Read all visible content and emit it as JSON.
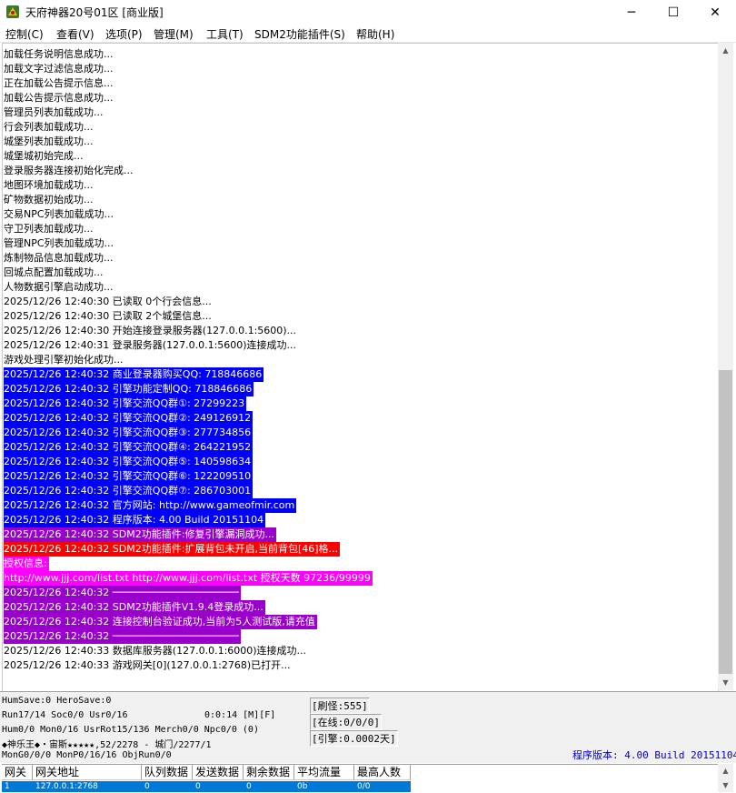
{
  "window": {
    "title": "天府神器20号01区 [商业版]",
    "minimize": "─",
    "maximize": "☐",
    "close": "✕"
  },
  "menu": [
    "控制(C)",
    "查看(V)",
    "选项(P)",
    "管理(M)",
    "工具(T)",
    "SDM2功能插件(S)",
    "帮助(H)"
  ],
  "colors": {
    "blue_highlight": "#0000ff",
    "purple_highlight": "#9900cc",
    "red_highlight": "#ff0000",
    "magenta_highlight": "#ff00ff",
    "selection": "#0078d7"
  },
  "log_lines": [
    {
      "text": "加载任务说明信息成功...",
      "bg": "",
      "fg": ""
    },
    {
      "text": "加载文字过滤信息成功...",
      "bg": "",
      "fg": ""
    },
    {
      "text": "正在加载公告提示信息...",
      "bg": "",
      "fg": ""
    },
    {
      "text": "加载公告提示信息成功...",
      "bg": "",
      "fg": ""
    },
    {
      "text": "管理员列表加载成功...",
      "bg": "",
      "fg": ""
    },
    {
      "text": "行会列表加载成功...",
      "bg": "",
      "fg": ""
    },
    {
      "text": "城堡列表加载成功...",
      "bg": "",
      "fg": ""
    },
    {
      "text": "城堡城初始完成...",
      "bg": "",
      "fg": ""
    },
    {
      "text": "登录服务器连接初始化完成...",
      "bg": "",
      "fg": ""
    },
    {
      "text": "地图环境加载成功...",
      "bg": "",
      "fg": ""
    },
    {
      "text": "矿物数据初始成功...",
      "bg": "",
      "fg": ""
    },
    {
      "text": "交易NPC列表加载成功...",
      "bg": "",
      "fg": ""
    },
    {
      "text": "守卫列表加载成功...",
      "bg": "",
      "fg": ""
    },
    {
      "text": "管理NPC列表加载成功...",
      "bg": "",
      "fg": ""
    },
    {
      "text": "炼制物品信息加载成功...",
      "bg": "",
      "fg": ""
    },
    {
      "text": "回城点配置加载成功...",
      "bg": "",
      "fg": ""
    },
    {
      "text": "人物数据引擎启动成功...",
      "bg": "",
      "fg": ""
    },
    {
      "text": "2025/12/26 12:40:30 已读取 0个行会信息...",
      "bg": "",
      "fg": ""
    },
    {
      "text": "2025/12/26 12:40:30 已读取 2个城堡信息...",
      "bg": "",
      "fg": ""
    },
    {
      "text": "2025/12/26 12:40:30 开始连接登录服务器(127.0.0.1:5600)...",
      "bg": "",
      "fg": ""
    },
    {
      "text": "2025/12/26 12:40:31 登录服务器(127.0.0.1:5600)连接成功...",
      "bg": "",
      "fg": ""
    },
    {
      "text": "游戏处理引擎初始化成功...",
      "bg": "",
      "fg": ""
    },
    {
      "text": "2025/12/26 12:40:32 商业登录器购买QQ: 718846686",
      "bg": "#0000ff",
      "fg": "#ffffff"
    },
    {
      "text": "2025/12/26 12:40:32 引擎功能定制QQ: 718846686",
      "bg": "#0000ff",
      "fg": "#ffffff"
    },
    {
      "text": "2025/12/26 12:40:32 引擎交流QQ群①: 27299223",
      "bg": "#0000ff",
      "fg": "#ffffff"
    },
    {
      "text": "2025/12/26 12:40:32 引擎交流QQ群②: 249126912",
      "bg": "#0000ff",
      "fg": "#ffffff"
    },
    {
      "text": "2025/12/26 12:40:32 引擎交流QQ群③: 277734856",
      "bg": "#0000ff",
      "fg": "#ffffff"
    },
    {
      "text": "2025/12/26 12:40:32 引擎交流QQ群④: 264221952",
      "bg": "#0000ff",
      "fg": "#ffffff"
    },
    {
      "text": "2025/12/26 12:40:32 引擎交流QQ群⑤: 140598634",
      "bg": "#0000ff",
      "fg": "#ffffff"
    },
    {
      "text": "2025/12/26 12:40:32 引擎交流QQ群⑥: 122209510",
      "bg": "#0000ff",
      "fg": "#ffffff"
    },
    {
      "text": "2025/12/26 12:40:32 引擎交流QQ群⑦: 286703001",
      "bg": "#0000ff",
      "fg": "#ffffff"
    },
    {
      "text": "2025/12/26 12:40:32 官方网站: http://www.gameofmir.com",
      "bg": "#0000ff",
      "fg": "#ffffff"
    },
    {
      "text": "2025/12/26 12:40:32 程序版本: 4.00 Build 20151104",
      "bg": "#0000ff",
      "fg": "#ffffff"
    },
    {
      "text": "2025/12/26 12:40:32 SDM2功能插件:修复引擎漏洞成功...",
      "bg": "#9900cc",
      "fg": "#ffffff"
    },
    {
      "text": "2025/12/26 12:40:32 SDM2功能插件:扩展背包未开启,当前背包[46]格...",
      "bg": "#ff0000",
      "fg": "#ffffff"
    },
    {
      "text": "授权信息:",
      "bg": "#ff00ff",
      "fg": "#ffffff"
    },
    {
      "text": "http://www.jjj.com/list.txt http://www.jjj.com/list.txt 授权天数 97236/99999",
      "bg": "#ff00ff",
      "fg": "#ffffff"
    },
    {
      "text": "2025/12/26 12:40:32 ─────────────────────",
      "bg": "#9900cc",
      "fg": "#ffffff"
    },
    {
      "text": "2025/12/26 12:40:32 SDM2功能插件V1.9.4登录成功...",
      "bg": "#9900cc",
      "fg": "#ffffff"
    },
    {
      "text": "2025/12/26 12:40:32 连接控制台验证成功,当前为5人测试版,请充值",
      "bg": "#9900cc",
      "fg": "#ffffff"
    },
    {
      "text": "2025/12/26 12:40:32 ─────────────────────",
      "bg": "#9900cc",
      "fg": "#ffffff"
    },
    {
      "text": "2025/12/26 12:40:33 数据库服务器(127.0.0.1:6000)连接成功...",
      "bg": "",
      "fg": ""
    },
    {
      "text": "2025/12/26 12:40:33 游戏网关[0](127.0.0.1:2768)已打开...",
      "bg": "",
      "fg": ""
    }
  ],
  "status": {
    "line1": "HumSave:0 HeroSave:0",
    "line2": "Run17/14 Soc0/0 Usr0/16",
    "timer": "0:0:14 [M][F]",
    "line3": "Hum0/0 Mon0/16 UsrRot15/136 Merch0/0 Npc0/0 (0)",
    "line4": "◆神乐王◆・宙斯★★★★★,52/2278 - 城门/2277/1",
    "line5": "MonG0/0/0 MonP0/16/16 ObjRun0/0",
    "box1": "[刷怪:555]",
    "box2": "[在线:0/0/0]",
    "box3": "[引擎:0.0002天]",
    "version": "程序版本: 4.00 Build 20151104"
  },
  "gate_table": {
    "headers": [
      "网关",
      "网关地址",
      "队列数据",
      "发送数据",
      "剩余数据",
      "平均流量",
      "最高人数"
    ],
    "row": [
      "1",
      "127.0.0.1:2768",
      "0",
      "0",
      "0",
      "0b",
      "0/0"
    ]
  }
}
